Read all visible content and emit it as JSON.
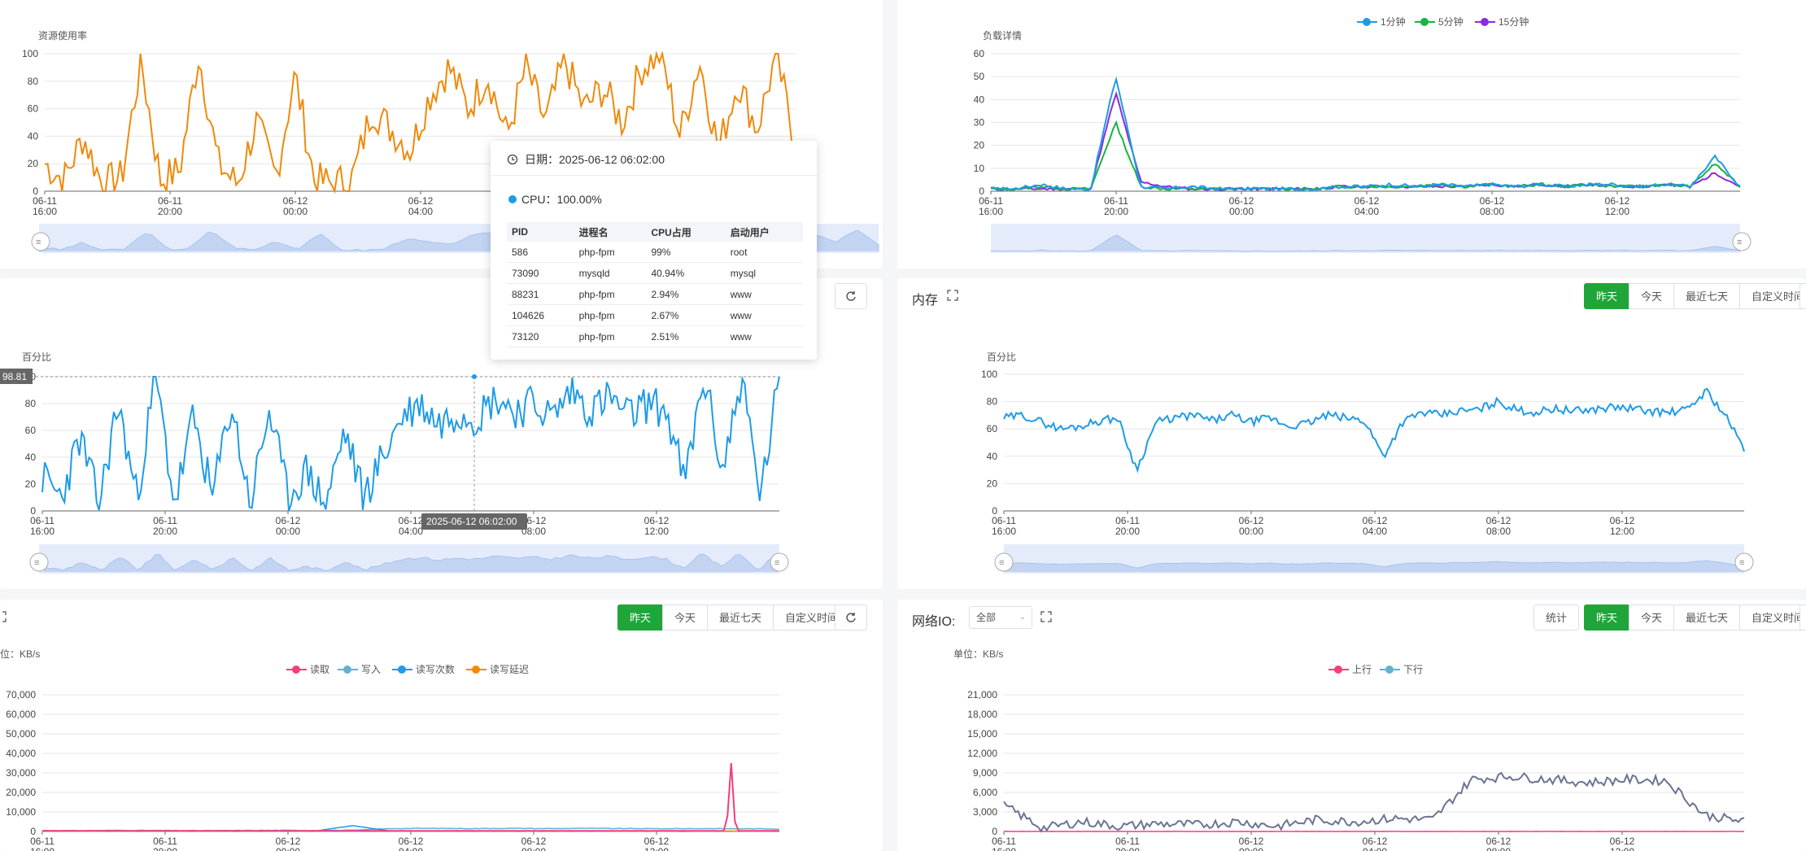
{
  "colors": {
    "green": "#20a53a",
    "orange": "#f0890b",
    "blue": "#1e9be8",
    "purple": "#8b2be0",
    "green_line": "#18b340",
    "pink": "#f53d7e",
    "teal": "#62b2d0",
    "slate": "#6b7494",
    "io_orange": "#f7870b"
  },
  "resource": {
    "title": "资源使用率"
  },
  "load": {
    "title": "负载详情",
    "legend": [
      "1分钟",
      "5分钟",
      "15分钟"
    ]
  },
  "cpu_panel": {
    "ylabel": "百分比",
    "marker_value": "98.81",
    "pointer_label": "2025-06-12 06:02:00",
    "refresh_icon": "refresh-icon"
  },
  "mem_panel": {
    "title": "内存",
    "ylabel": "百分比",
    "buttons": [
      "昨天",
      "今天",
      "最近七天",
      "自定义时间"
    ]
  },
  "disk_panel": {
    "unit": "位：KB/s",
    "legend": [
      "读取",
      "写入",
      "读写次数",
      "读写延迟"
    ],
    "buttons": [
      "昨天",
      "今天",
      "最近七天",
      "自定义时间"
    ]
  },
  "net_panel": {
    "title": "网络IO:",
    "select_value": "全部",
    "stats_button": "统计",
    "unit": "单位：KB/s",
    "legend": [
      "上行",
      "下行"
    ],
    "buttons": [
      "昨天",
      "今天",
      "最近七天",
      "自定义时间"
    ]
  },
  "tooltip": {
    "date_label": "日期：2025-06-12 06:02:00",
    "cpu_label": "CPU：100.00%",
    "headers": [
      "PID",
      "进程名",
      "CPU占用",
      "启动用户"
    ],
    "rows": [
      [
        "586",
        "php-fpm",
        "99%",
        "root"
      ],
      [
        "73090",
        "mysqld",
        "40.94%",
        "mysql"
      ],
      [
        "88231",
        "php-fpm",
        "2.94%",
        "www"
      ],
      [
        "104626",
        "php-fpm",
        "2.67%",
        "www"
      ],
      [
        "73120",
        "php-fpm",
        "2.51%",
        "www"
      ]
    ]
  },
  "x_ticks": [
    "06-11 16:00",
    "06-11 20:00",
    "06-12 00:00",
    "06-12 04:00",
    "06-12 08:00",
    "06-12 12:00"
  ],
  "x_ticks_cpu_visible": [
    "06-11 16:00",
    "06-11 20:00",
    "06-12 00:00",
    "06-12 04:00",
    "06-12 08:00",
    "06-12 12:00"
  ],
  "chart_data": [
    {
      "type": "line",
      "title": "资源使用率",
      "ylim": [
        0,
        100
      ],
      "yticks": [
        "0",
        "20",
        "40",
        "60",
        "80",
        "100"
      ],
      "series": [
        {
          "values_desc": "orange CPU usage",
          "values": [
            20,
            8,
            40,
            5,
            10,
            95,
            8,
            15,
            100,
            20,
            5,
            50,
            10,
            85,
            8,
            5,
            10,
            60,
            45,
            30,
            70,
            90,
            60,
            85,
            40,
            90,
            50,
            95,
            60,
            75,
            50,
            90,
            100,
            40,
            95,
            30,
            80,
            45,
            100,
            30
          ]
        }
      ]
    },
    {
      "type": "line",
      "title": "负载详情",
      "ylim": [
        0,
        60
      ],
      "yticks": [
        "0",
        "10",
        "20",
        "30",
        "40",
        "50",
        "60"
      ],
      "series": [
        {
          "name": "1分钟",
          "values": [
            1,
            1,
            3,
            1,
            1,
            50,
            2,
            1,
            2,
            1,
            1,
            1,
            1,
            1,
            2,
            2,
            3,
            2,
            3,
            2,
            3,
            2,
            3,
            2,
            3,
            3,
            2,
            3,
            2,
            15,
            2
          ]
        },
        {
          "name": "5分钟",
          "values": [
            1,
            1,
            2,
            1,
            1,
            30,
            2,
            1,
            1,
            1,
            1,
            1,
            1,
            1,
            2,
            2,
            2,
            2,
            3,
            2,
            3,
            2,
            3,
            2,
            3,
            2,
            2,
            3,
            2,
            12,
            2
          ]
        },
        {
          "name": "15分钟",
          "values": [
            1,
            1,
            1,
            1,
            1,
            43,
            4,
            2,
            1,
            1,
            1,
            1,
            1,
            1,
            2,
            2,
            2,
            2,
            2,
            2,
            3,
            2,
            3,
            2,
            3,
            2,
            2,
            3,
            2,
            8,
            2
          ]
        }
      ]
    },
    {
      "type": "line",
      "title": "",
      "ylabel": "百分比",
      "ylim": [
        0,
        100
      ],
      "yticks": [
        "0",
        "20",
        "40",
        "60",
        "80",
        "100"
      ],
      "series": [
        {
          "values": [
            25,
            10,
            55,
            5,
            80,
            10,
            100,
            5,
            70,
            10,
            80,
            5,
            75,
            10,
            30,
            5,
            60,
            10,
            40,
            70,
            80,
            65,
            75,
            70,
            85,
            75,
            80,
            70,
            90,
            75,
            85,
            70,
            80,
            75,
            20,
            100,
            30,
            100,
            10,
            100
          ]
        }
      ]
    },
    {
      "type": "line",
      "title": "",
      "ylabel": "百分比",
      "ylim": [
        0,
        100
      ],
      "yticks": [
        "0",
        "20",
        "40",
        "60",
        "80",
        "100"
      ],
      "series": [
        {
          "values": [
            68,
            70,
            65,
            60,
            62,
            66,
            68,
            30,
            65,
            68,
            70,
            66,
            70,
            65,
            68,
            62,
            64,
            70,
            68,
            66,
            40,
            65,
            72,
            70,
            73,
            74,
            80,
            74,
            72,
            75,
            73,
            74,
            76,
            75,
            73,
            72,
            74,
            88,
            70,
            45
          ]
        }
      ]
    },
    {
      "type": "line",
      "title": "",
      "unit": "位：KB/s",
      "ylim": [
        0,
        70000
      ],
      "yticks": [
        "0",
        "10,000",
        "20,000",
        "30,000",
        "40,000",
        "50,000",
        "60,000",
        "70,000"
      ],
      "series": [
        {
          "name": "读取",
          "values": [
            300,
            300,
            300,
            300,
            300,
            300,
            300,
            300,
            300,
            300,
            300,
            300,
            300,
            300,
            300,
            300,
            300,
            300,
            35000,
            300
          ]
        },
        {
          "name": "写入",
          "values": [
            500,
            400,
            600,
            500,
            400,
            500,
            600,
            500,
            600,
            1500,
            1600,
            1500,
            1600,
            1500,
            1600,
            1500,
            1400,
            1500,
            1400,
            1300
          ]
        },
        {
          "name": "读写次数",
          "values": [
            100,
            100,
            100,
            100,
            100,
            100,
            100,
            100,
            3000,
            100,
            100,
            100,
            100,
            100,
            100,
            100,
            100,
            100,
            100,
            100
          ]
        },
        {
          "name": "读写延迟",
          "values": [
            200,
            200,
            200,
            200,
            200,
            200,
            200,
            200,
            200,
            200,
            200,
            200,
            200,
            200,
            200,
            200,
            200,
            200,
            200,
            200
          ]
        }
      ]
    },
    {
      "type": "line",
      "title": "",
      "unit": "单位：KB/s",
      "ylim": [
        0,
        21000
      ],
      "yticks": [
        "0",
        "3,000",
        "6,000",
        "9,000",
        "12,000",
        "15,000",
        "18,000",
        "21,000"
      ],
      "series": [
        {
          "name": "上行",
          "values": [
            0,
            0,
            0,
            0,
            0,
            0,
            0,
            0,
            0,
            0,
            0,
            0,
            0,
            0,
            0,
            0,
            0,
            0,
            0,
            0
          ]
        },
        {
          "name": "下行",
          "values": [
            4000,
            500,
            1500,
            800,
            1200,
            1000,
            1500,
            800,
            1800,
            1500,
            2000,
            1800,
            8000,
            8500,
            8000,
            7500,
            8000,
            7800,
            2500,
            1500
          ]
        }
      ]
    }
  ]
}
